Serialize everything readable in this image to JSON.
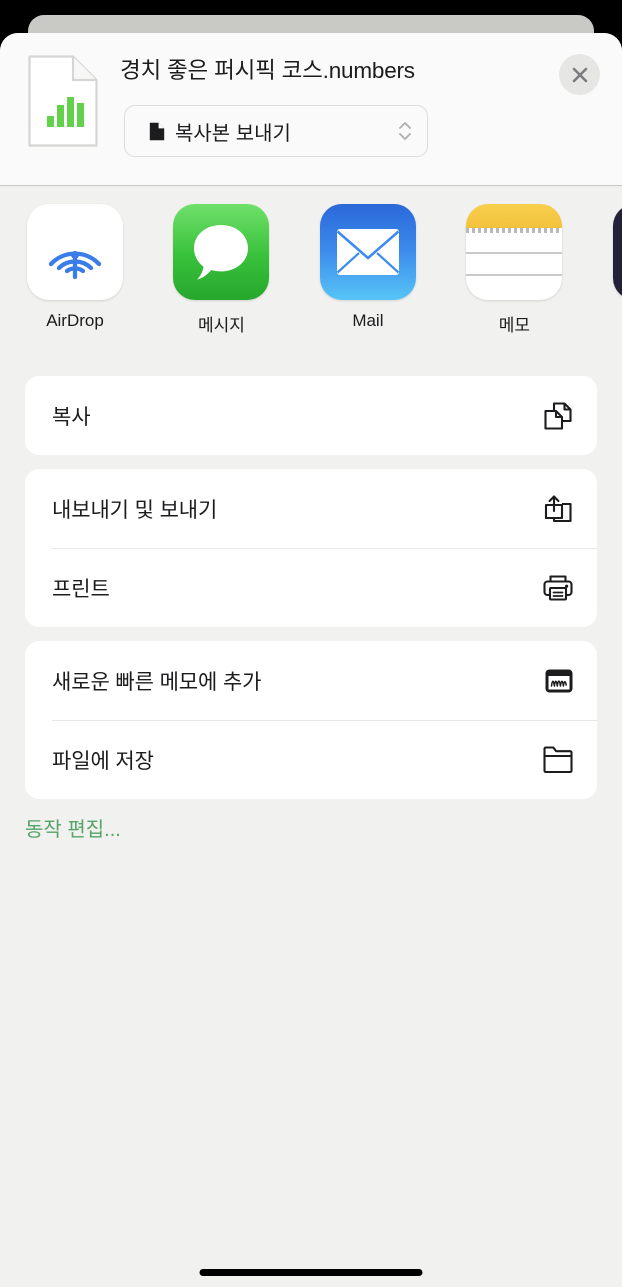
{
  "sheet": {
    "document_title": "경치 좋은 퍼시픽 코스.numbers",
    "close_label": "✕",
    "options": {
      "label": "복사본 보내기",
      "doc_icon": "document-filled-icon",
      "chevron_icon": "chevron-up-down-icon"
    },
    "thumbnail": {
      "icon": "numbers-document-icon",
      "bar_color": "#64d14d"
    }
  },
  "apps": [
    {
      "label": "AirDrop",
      "icon": "airdrop-icon"
    },
    {
      "label": "메시지",
      "icon": "messages-icon"
    },
    {
      "label": "Mail",
      "icon": "mail-icon"
    },
    {
      "label": "메모",
      "icon": "notes-icon"
    },
    {
      "label": "",
      "icon": "partial-app-icon"
    }
  ],
  "action_groups": [
    {
      "rows": [
        {
          "label": "복사",
          "icon": "copy-icon"
        }
      ]
    },
    {
      "rows": [
        {
          "label": "내보내기 및 보내기",
          "icon": "export-share-icon"
        },
        {
          "label": "프린트",
          "icon": "printer-icon"
        }
      ]
    },
    {
      "rows": [
        {
          "label": "새로운 빠른 메모에 추가",
          "icon": "quick-note-icon"
        },
        {
          "label": "파일에 저장",
          "icon": "folder-icon"
        }
      ]
    }
  ],
  "edit_actions": {
    "label": "동작 편집...",
    "color": "#55a468"
  },
  "colors": {
    "sheet_background": "#f1f1ef",
    "header_background": "#fafafa",
    "card_background": "#ffffff",
    "text_primary": "#1c1c1e",
    "accent_green": "#55a468",
    "numbers_green": "#64d14d"
  }
}
